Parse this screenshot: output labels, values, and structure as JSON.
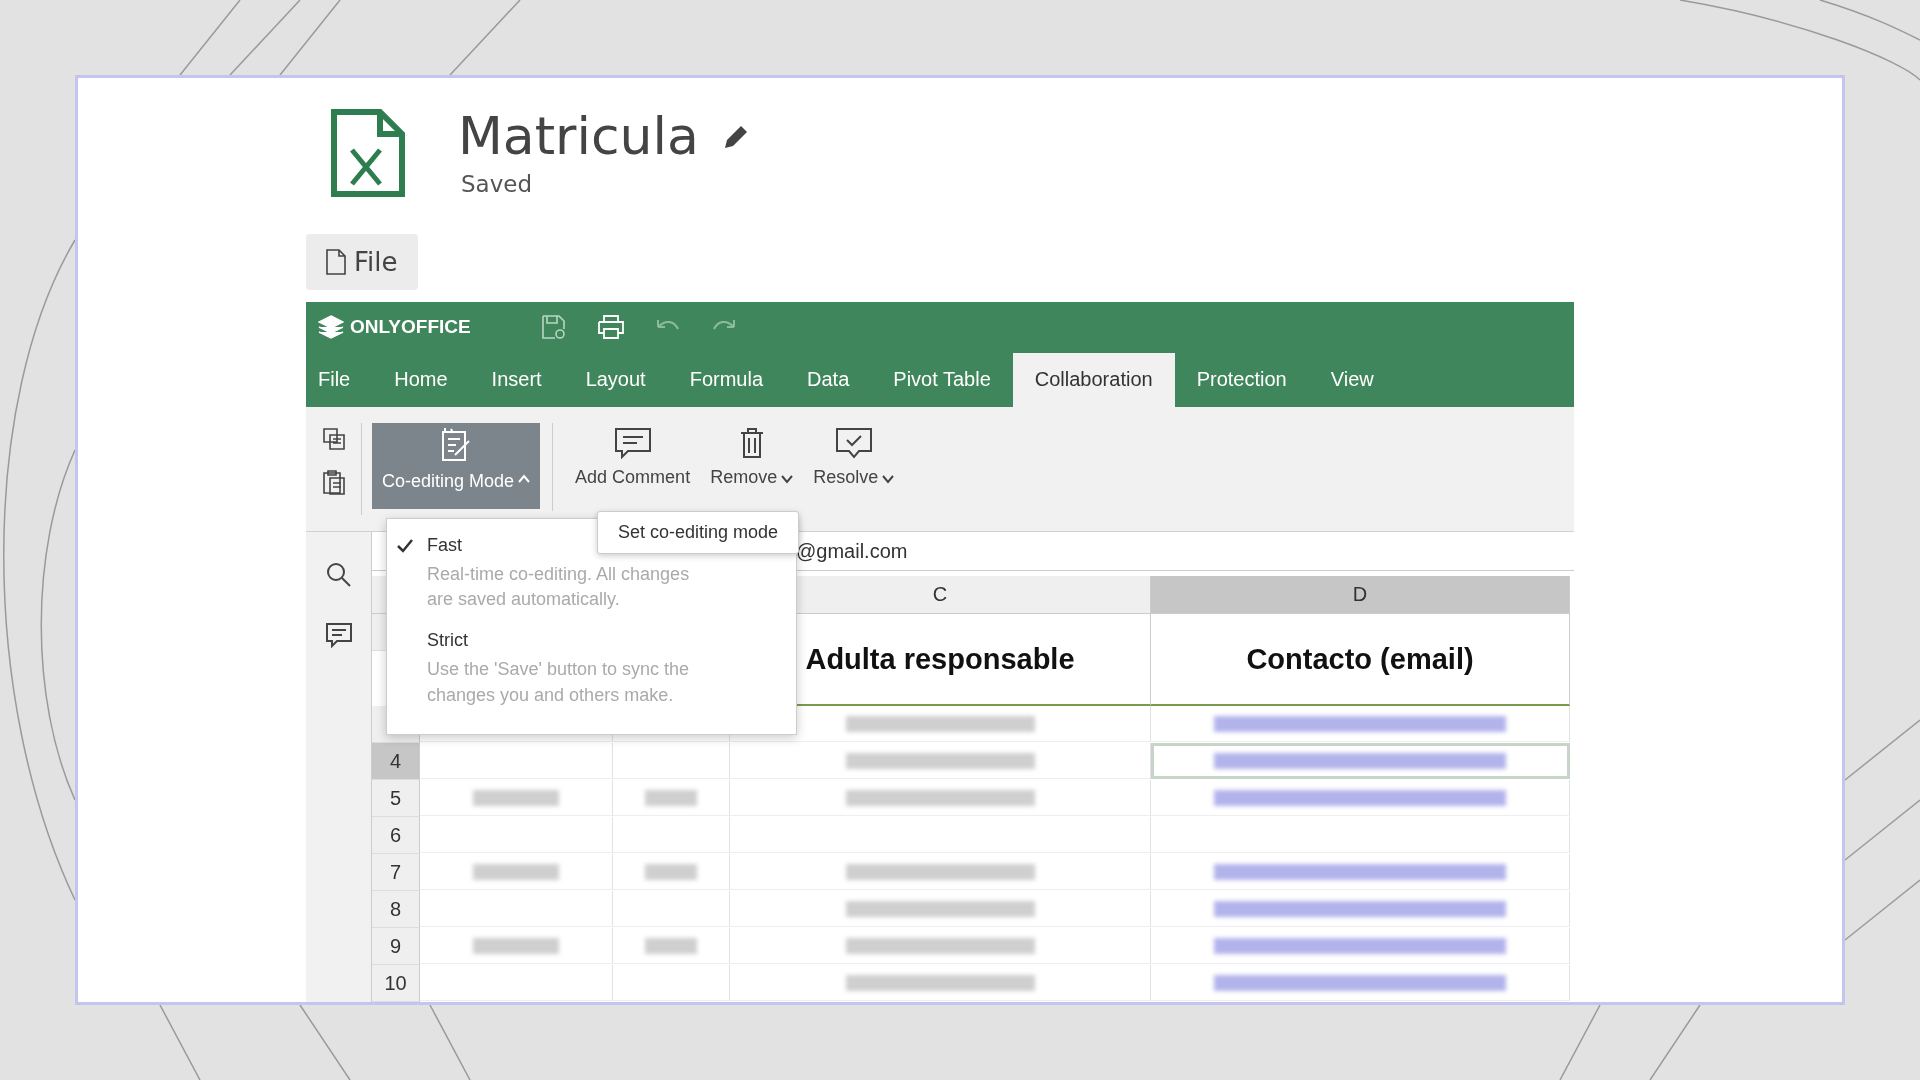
{
  "document": {
    "title": "Matricula",
    "status": "Saved"
  },
  "file_button": {
    "label": "File"
  },
  "editor": {
    "brand": "ONLYOFFICE",
    "tabs": [
      {
        "label": "File",
        "selected": false
      },
      {
        "label": "Home",
        "selected": false
      },
      {
        "label": "Insert",
        "selected": false
      },
      {
        "label": "Layout",
        "selected": false
      },
      {
        "label": "Formula",
        "selected": false
      },
      {
        "label": "Data",
        "selected": false
      },
      {
        "label": "Pivot Table",
        "selected": false
      },
      {
        "label": "Collaboration",
        "selected": true
      },
      {
        "label": "Protection",
        "selected": false
      },
      {
        "label": "View",
        "selected": false
      }
    ],
    "ribbon": [
      {
        "kind": "coedit",
        "label": "Co-editing Mode",
        "pressed": true,
        "has_menu": true,
        "open": true
      },
      {
        "kind": "comment",
        "label": "Add Comment",
        "pressed": false,
        "has_menu": false
      },
      {
        "kind": "remove",
        "label": "Remove",
        "pressed": false,
        "has_menu": true,
        "open": false
      },
      {
        "kind": "resolve",
        "label": "Resolve",
        "pressed": false,
        "has_menu": true,
        "open": false
      }
    ],
    "tooltip": "Set co-editing mode",
    "mode_menu": [
      {
        "label": "Fast",
        "description": "Real-time co-editing. All changes are saved automatically.",
        "checked": true
      },
      {
        "label": "Strict",
        "description": "Use the 'Save' button to sync the changes you and others make.",
        "checked": false
      }
    ],
    "formula_bar": {
      "value": "@gmail.com"
    },
    "sheet": {
      "columns": [
        {
          "label": "C",
          "selected": false
        },
        {
          "label": "D",
          "selected": true
        }
      ],
      "header_row": [
        "Adulta responsable",
        "Contacto (email)"
      ],
      "rows": [
        {
          "partial": true,
          "filled": [
            true,
            true
          ]
        },
        {
          "number": "4",
          "selected": true,
          "filled": [
            false,
            false,
            true,
            true
          ]
        },
        {
          "number": "5",
          "selected": false,
          "filled": [
            true,
            true,
            true,
            true
          ]
        },
        {
          "number": "6",
          "selected": false,
          "filled": [
            false,
            false,
            false,
            false
          ]
        },
        {
          "number": "7",
          "selected": false,
          "filled": [
            true,
            true,
            true,
            true
          ]
        },
        {
          "number": "8",
          "selected": false,
          "filled": [
            false,
            false,
            true,
            true
          ]
        },
        {
          "number": "9",
          "selected": false,
          "filled": [
            true,
            true,
            true,
            true
          ]
        },
        {
          "number": "10",
          "selected": false,
          "filled": [
            false,
            false,
            true,
            true
          ]
        }
      ]
    }
  }
}
